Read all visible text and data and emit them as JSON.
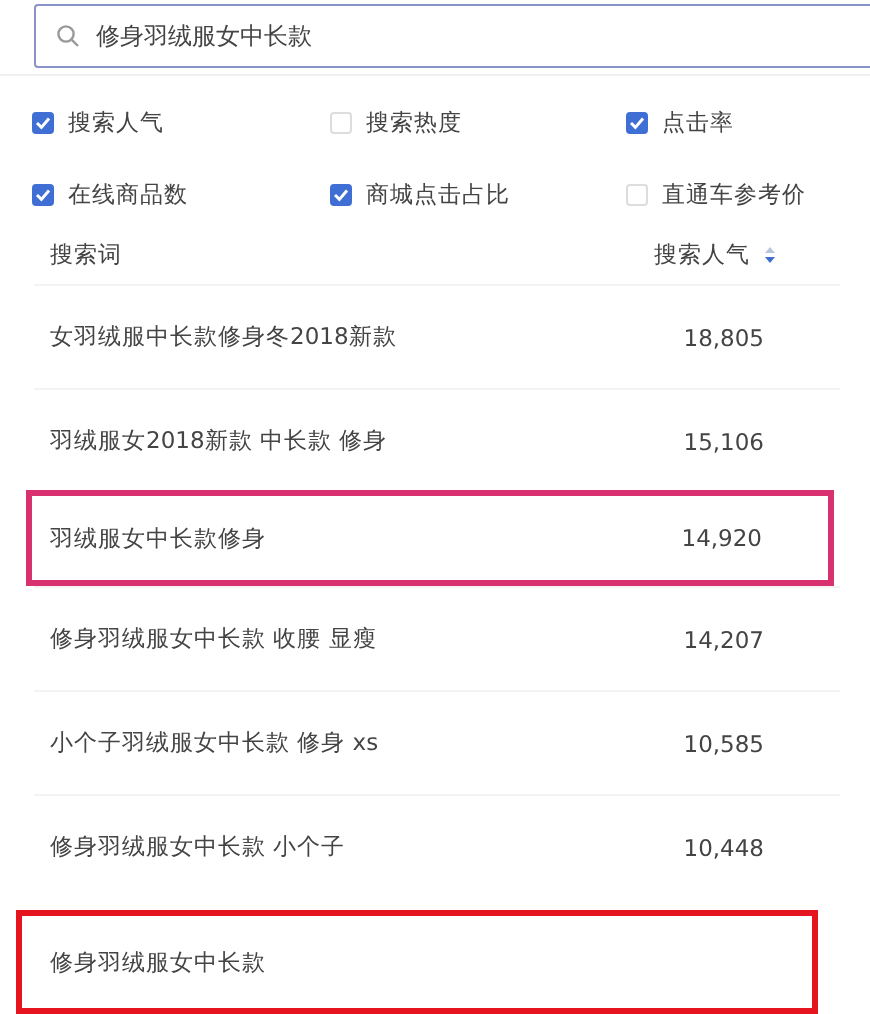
{
  "search": {
    "value": "修身羽绒服女中长款"
  },
  "filters": [
    {
      "label": "搜索人气",
      "checked": true
    },
    {
      "label": "搜索热度",
      "checked": false
    },
    {
      "label": "点击率",
      "checked": true
    },
    {
      "label": "在线商品数",
      "checked": true
    },
    {
      "label": "商城点击占比",
      "checked": true
    },
    {
      "label": "直通车参考价",
      "checked": false
    }
  ],
  "table": {
    "columns": [
      {
        "label": "搜索词",
        "sortable": false
      },
      {
        "label": "搜索人气",
        "sortable": true
      }
    ],
    "rows": [
      {
        "term": "女羽绒服中长款修身冬2018新款",
        "popularity": "18,805"
      },
      {
        "term": "羽绒服女2018新款 中长款 修身",
        "popularity": "15,106"
      },
      {
        "term": "羽绒服女中长款修身",
        "popularity": "14,920",
        "color": "#d9306f"
      },
      {
        "term": "修身羽绒服女中长款 收腰 显瘦",
        "popularity": "14,207"
      },
      {
        "term": "小个子羽绒服女中长款 修身 xs",
        "popularity": "10,585"
      },
      {
        "term": "修身羽绒服女中长款 小个子",
        "popularity": "10,448"
      },
      {
        "term": "修身羽绒服女中长款",
        "color": "#e5141f"
      }
    ]
  }
}
